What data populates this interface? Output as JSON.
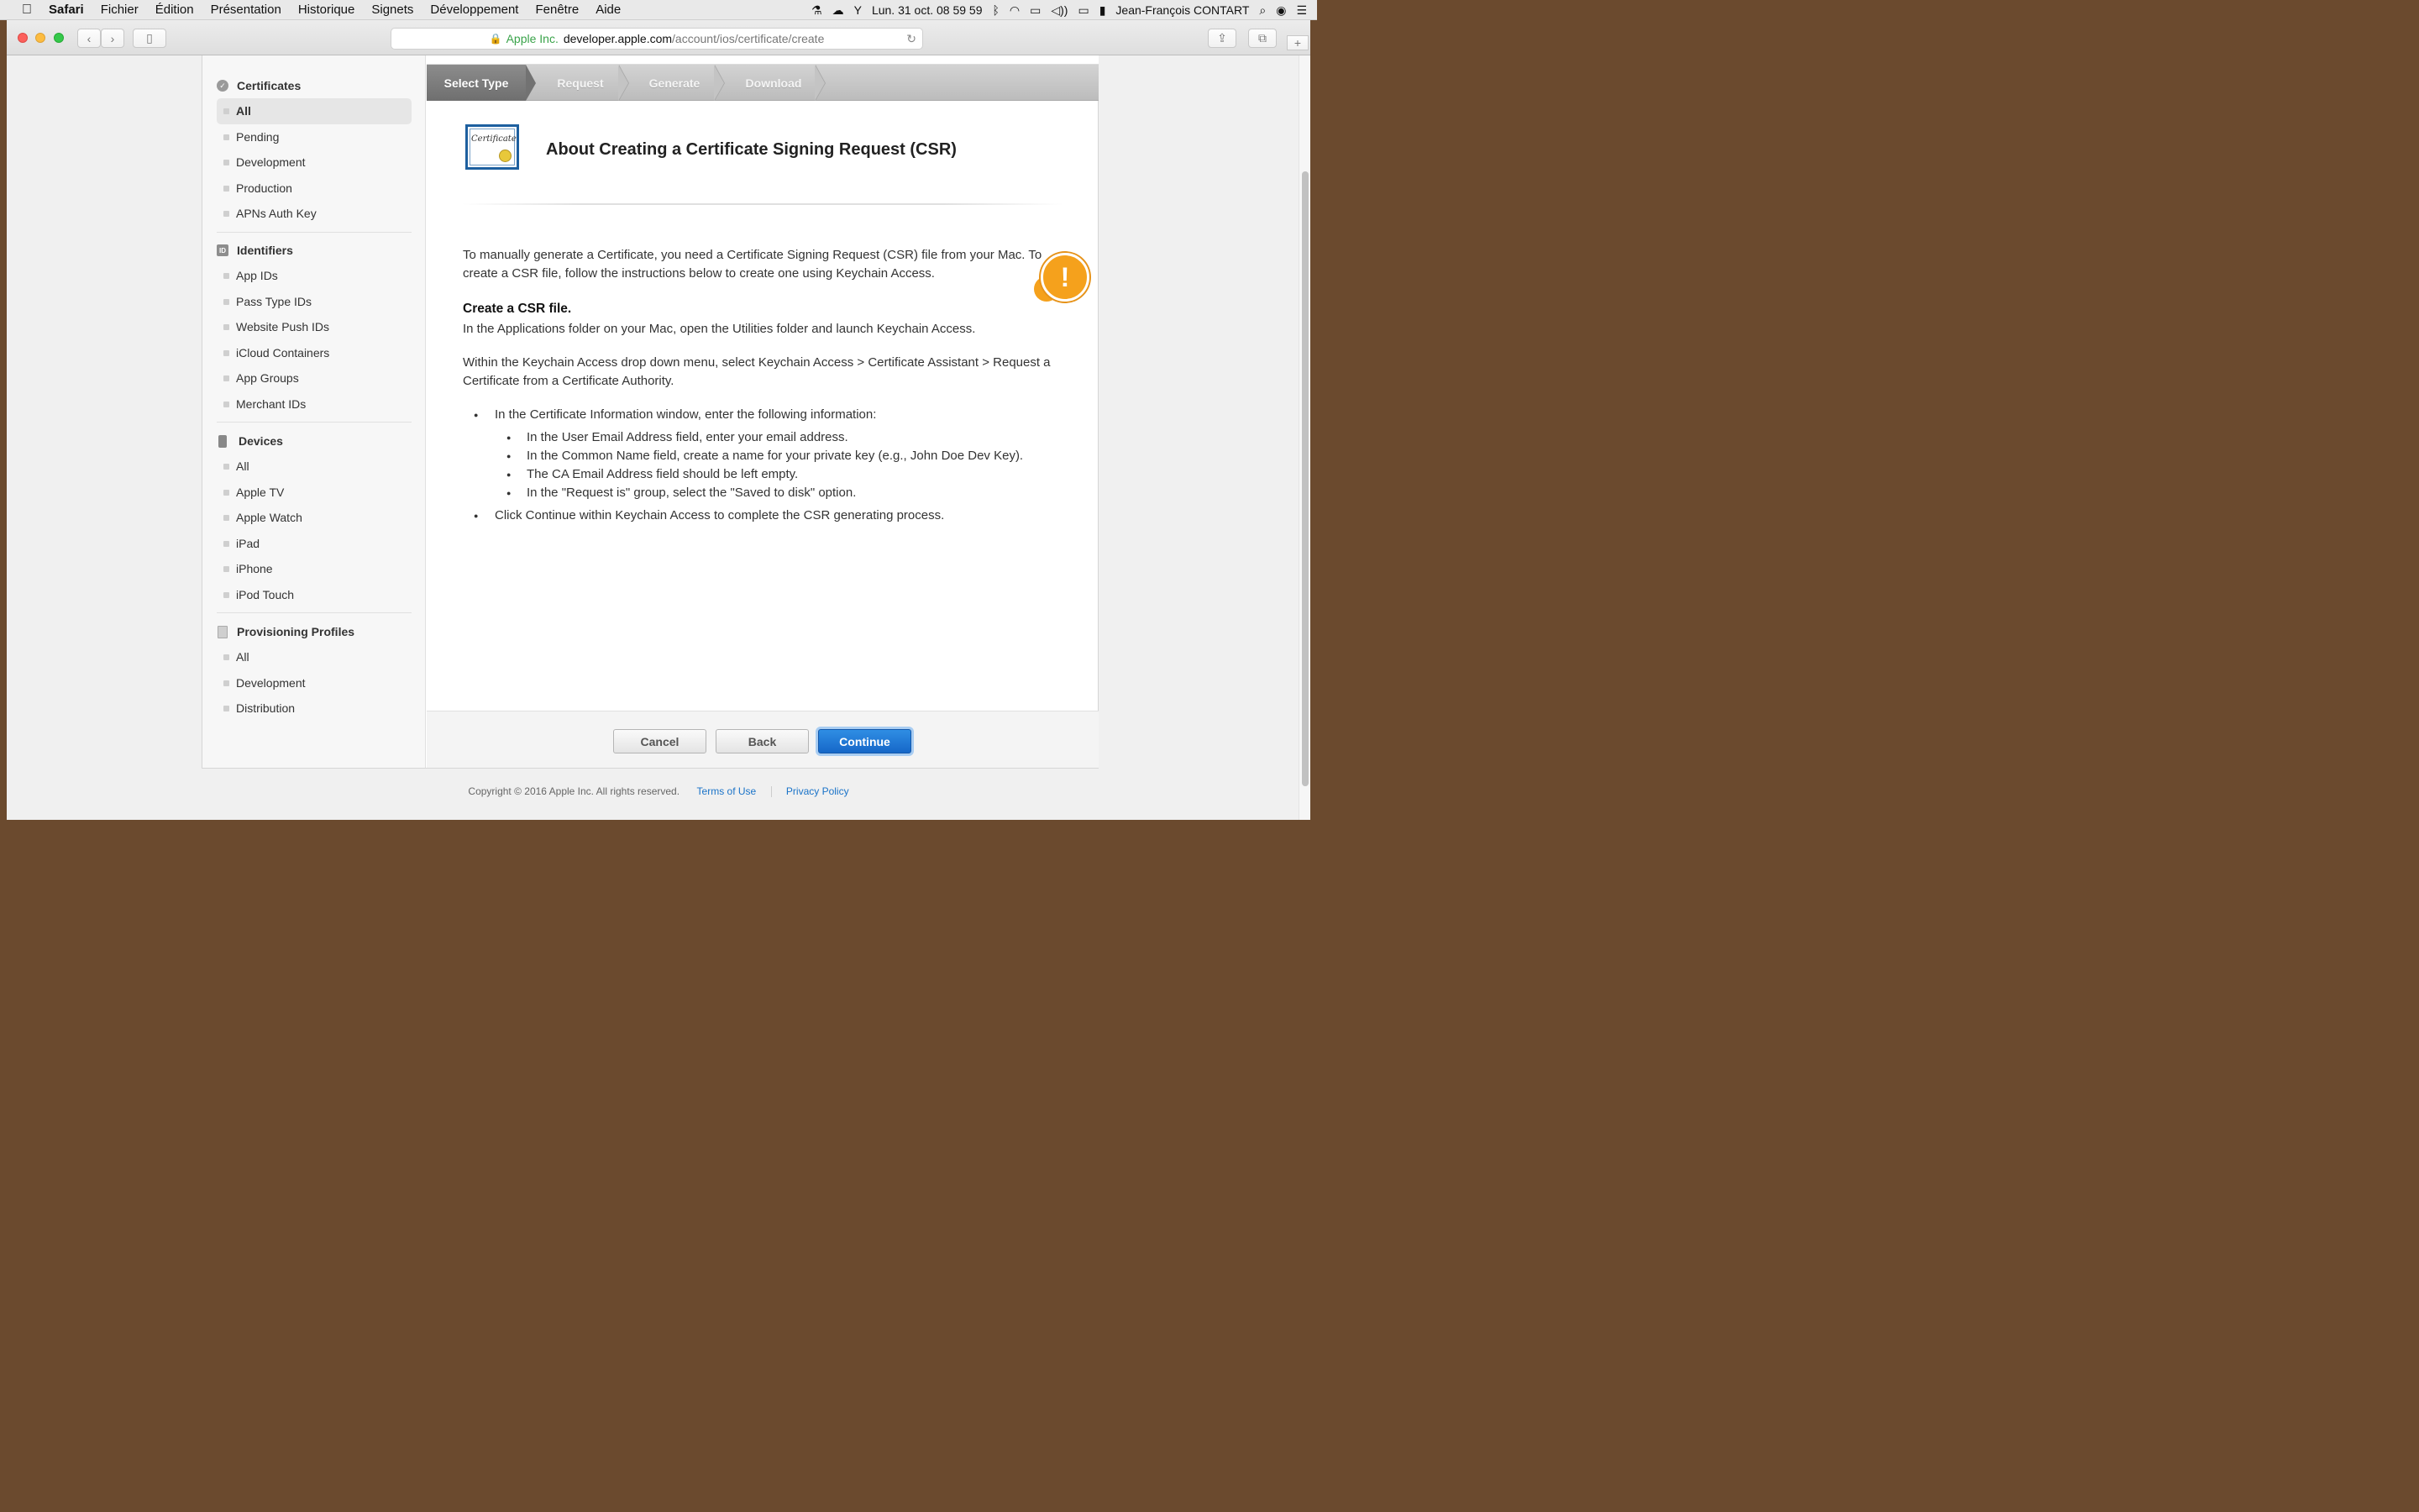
{
  "menubar": {
    "app": "Safari",
    "items": [
      "Fichier",
      "Édition",
      "Présentation",
      "Historique",
      "Signets",
      "Développement",
      "Fenêtre",
      "Aide"
    ],
    "clock": "Lun. 31 oct.  08 59 59",
    "user": "Jean-François CONTART"
  },
  "browser": {
    "org": "Apple Inc.",
    "host": "developer.apple.com",
    "path": "/account/ios/certificate/create"
  },
  "sidebar": {
    "sections": [
      {
        "title": "Certificates",
        "icon": "certificate-icon",
        "items": [
          "All",
          "Pending",
          "Development",
          "Production",
          "APNs Auth Key"
        ],
        "active": 0
      },
      {
        "title": "Identifiers",
        "icon": "id-icon",
        "items": [
          "App IDs",
          "Pass Type IDs",
          "Website Push IDs",
          "iCloud Containers",
          "App Groups",
          "Merchant IDs"
        ],
        "active": -1
      },
      {
        "title": "Devices",
        "icon": "device-icon",
        "items": [
          "All",
          "Apple TV",
          "Apple Watch",
          "iPad",
          "iPhone",
          "iPod Touch"
        ],
        "active": -1
      },
      {
        "title": "Provisioning Profiles",
        "icon": "document-icon",
        "items": [
          "All",
          "Development",
          "Distribution"
        ],
        "active": -1
      }
    ]
  },
  "steps": [
    "Select Type",
    "Request",
    "Generate",
    "Download"
  ],
  "main": {
    "cert_icon_text": "Certificate",
    "title": "About Creating a Certificate Signing Request (CSR)",
    "intro": "To manually generate a Certificate, you need a Certificate Signing Request (CSR) file from your Mac. To create a CSR file, follow the instructions below to create one using Keychain Access.",
    "subheading": "Create a CSR file.",
    "para1": "In the Applications folder on your Mac, open the Utilities folder and launch Keychain Access.",
    "para2": "Within the Keychain Access drop down menu, select Keychain Access > Certificate Assistant > Request a Certificate from a Certificate Authority.",
    "bullet1": "In the Certificate Information window, enter the following information:",
    "sub1": "In the User Email Address field, enter your email address.",
    "sub2": "In the Common Name field, create a name for your private key (e.g., John Doe Dev Key).",
    "sub3": "The CA Email Address field should be left empty.",
    "sub4": "In the \"Request is\" group, select the \"Saved to disk\" option.",
    "bullet2": "Click Continue within Keychain Access to complete the CSR generating process."
  },
  "buttons": {
    "cancel": "Cancel",
    "back": "Back",
    "continue": "Continue"
  },
  "footer": {
    "copyright": "Copyright © 2016 Apple Inc. All rights reserved.",
    "terms": "Terms of Use",
    "privacy": "Privacy Policy"
  },
  "colors": {
    "accent": "#1a73c8",
    "warning": "#f5a11c"
  }
}
